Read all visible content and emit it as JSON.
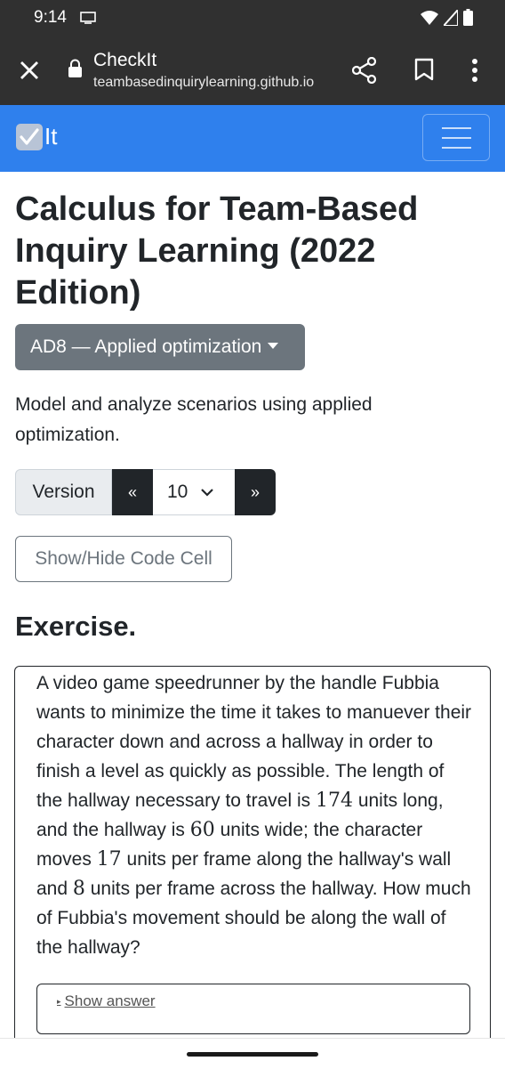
{
  "status_bar": {
    "time": "9:14"
  },
  "browser": {
    "title": "CheckIt",
    "url": "teambasedinquirylearning.github.io"
  },
  "navbar": {
    "brand_text": "It"
  },
  "page": {
    "title": "Calculus for Team-Based Inquiry Learning (2022 Edition)",
    "outcome_dropdown": "AD8 — Applied optimization",
    "description": "Model and analyze scenarios using applied optimization.",
    "version": {
      "label": "Version",
      "prev": "«",
      "selected": "10",
      "next": "»"
    },
    "code_cell_button": "Show/Hide Code Cell",
    "exercise_heading": "Exercise.",
    "exercise": {
      "part1": "A video game speedrunner by the handle Fubbia wants to minimize the time it takes to manuever their character down and across a hallway in order to finish a level as quickly as possible. The length of the hallway necessary to travel is ",
      "length": "174",
      "part2": " units long, and the hallway is ",
      "width": "60",
      "part3": " units wide; the character moves ",
      "speed_wall": "17",
      "part4": " units per frame along the hallway's wall and ",
      "speed_across": "8",
      "part5": " units per frame across the hallway. How much of Fubbia's movement should be along the wall of the hallway?"
    },
    "show_answer": "Show answer"
  }
}
